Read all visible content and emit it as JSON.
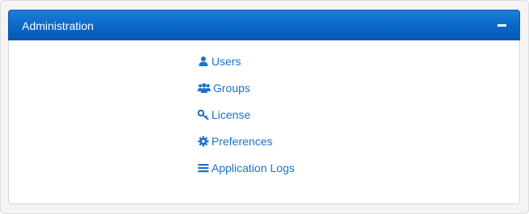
{
  "panel": {
    "title": "Administration",
    "collapse_icon": "minus-icon"
  },
  "menu": {
    "items": [
      {
        "label": "Users",
        "icon": "user-icon"
      },
      {
        "label": "Groups",
        "icon": "users-group-icon"
      },
      {
        "label": "License",
        "icon": "key-icon"
      },
      {
        "label": "Preferences",
        "icon": "gear-icon"
      },
      {
        "label": "Application Logs",
        "icon": "list-icon"
      }
    ]
  },
  "colors": {
    "header_top": "#1a80d9",
    "header_bottom": "#0558b5",
    "link": "#1a73c8"
  }
}
